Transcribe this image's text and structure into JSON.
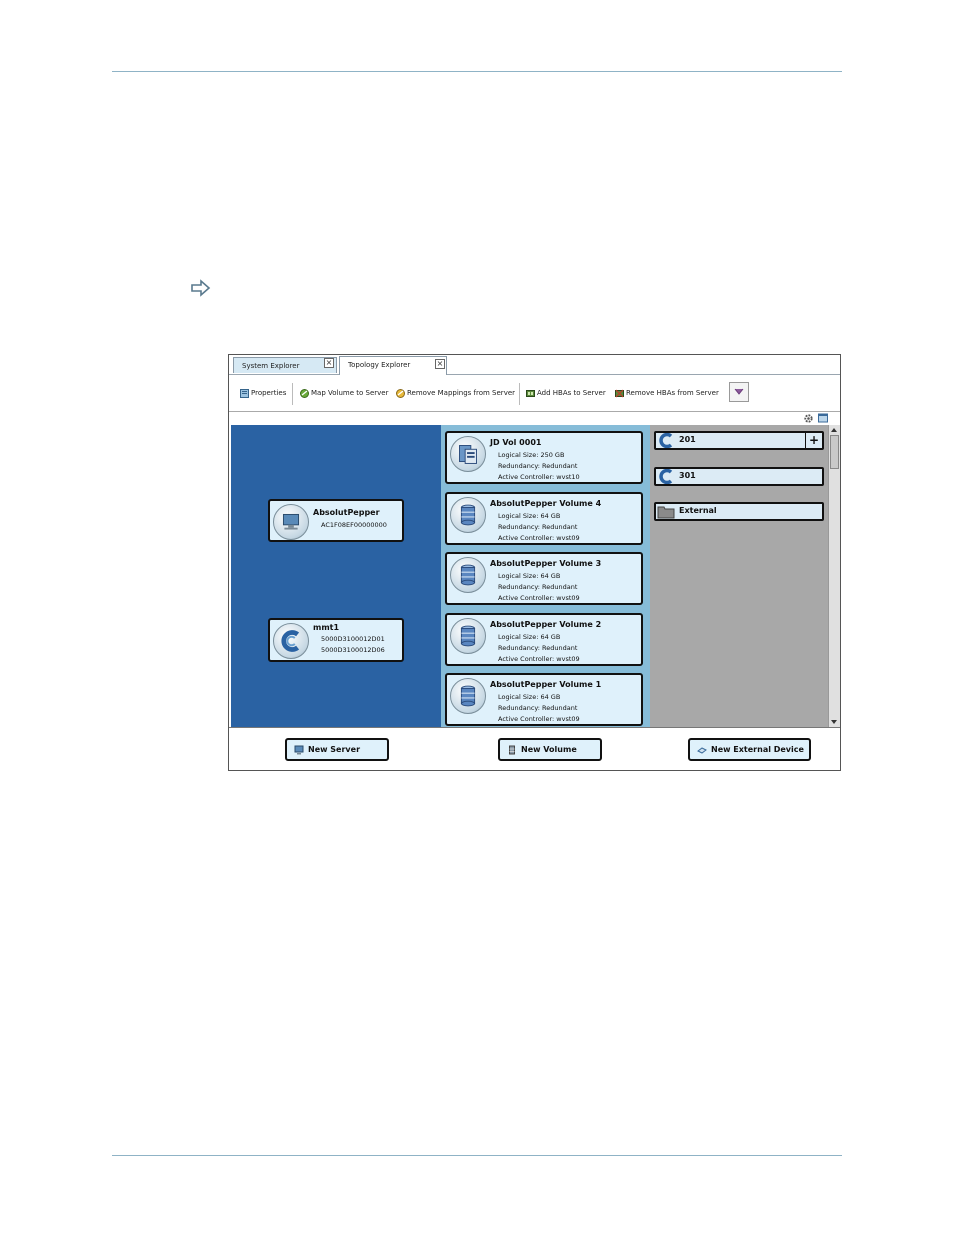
{
  "tabs": [
    {
      "label": "System Explorer",
      "active": false
    },
    {
      "label": "Topology Explorer",
      "active": true
    }
  ],
  "toolbar": {
    "properties": "Properties",
    "map_volume": "Map Volume to Server",
    "remove_mappings": "Remove Mappings from Server",
    "add_hbas": "Add HBAs to Server",
    "remove_hbas": "Remove HBAs from Server"
  },
  "servers": [
    {
      "name": "AbsolutPepper",
      "lines": [
        "AC1F08EF00000000"
      ],
      "icon": "server-monitor-icon"
    },
    {
      "name": "mmt1",
      "lines": [
        "5000D3100012D01",
        "5000D3100012D06"
      ],
      "icon": "compellent-logo-icon"
    }
  ],
  "volumes": [
    {
      "name": "JD Vol 0001",
      "size": "Logical Size: 250 GB",
      "redundancy": "Redundancy: Redundant",
      "controller": "Active Controller: wvst10"
    },
    {
      "name": "AbsolutPepper Volume 4",
      "size": "Logical Size: 64 GB",
      "redundancy": "Redundancy: Redundant",
      "controller": "Active Controller: wvst09"
    },
    {
      "name": "AbsolutPepper Volume 3",
      "size": "Logical Size: 64 GB",
      "redundancy": "Redundancy: Redundant",
      "controller": "Active Controller: wvst09"
    },
    {
      "name": "AbsolutPepper Volume 2",
      "size": "Logical Size: 64 GB",
      "redundancy": "Redundancy: Redundant",
      "controller": "Active Controller: wvst09"
    },
    {
      "name": "AbsolutPepper Volume 1",
      "size": "Logical Size: 64 GB",
      "redundancy": "Redundancy: Redundant",
      "controller": "Active Controller: wvst09"
    }
  ],
  "devices": [
    {
      "label": "201",
      "icon": "compellent-logo-icon"
    },
    {
      "label": "301",
      "icon": "compellent-logo-icon"
    },
    {
      "label": "External",
      "icon": "folder-icon"
    }
  ],
  "bottom": {
    "new_server": "New Server",
    "new_volume": "New Volume",
    "new_external": "New External Device"
  },
  "colors": {
    "left_pane": "#2a62a3",
    "middle_pane": "#86bcd8",
    "right_pane": "#a8a8a8",
    "card_fill": "#dff1fb"
  }
}
